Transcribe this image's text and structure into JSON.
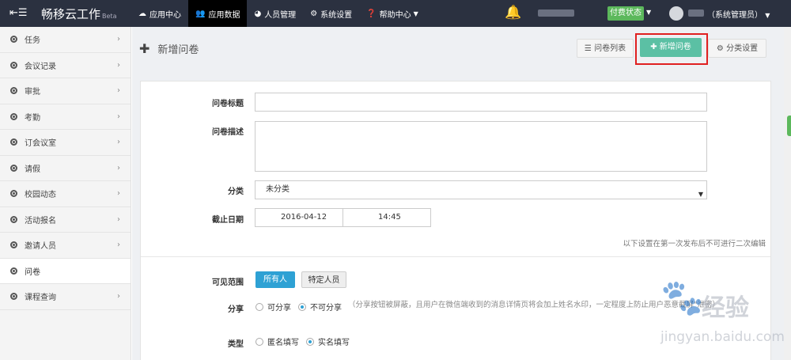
{
  "app": {
    "toggle_icon": "menu-collapse-icon",
    "brand": "畅移云工作",
    "beta": "Beta"
  },
  "nav": [
    {
      "label": "应用中心",
      "icon": "cloud-icon",
      "active": false
    },
    {
      "label": "应用数据",
      "icon": "users-icon",
      "active": true
    },
    {
      "label": "人员管理",
      "icon": "dashboard-icon",
      "active": false
    },
    {
      "label": "系统设置",
      "icon": "cogs-icon",
      "active": false
    },
    {
      "label": "帮助中心",
      "icon": "question-icon",
      "active": false
    }
  ],
  "header": {
    "paid_status": "付费状态",
    "role": "（系统管理员）"
  },
  "sidebar": {
    "items": [
      {
        "label": "任务"
      },
      {
        "label": "会议记录"
      },
      {
        "label": "审批"
      },
      {
        "label": "考勤"
      },
      {
        "label": "订会议室"
      },
      {
        "label": "请假"
      },
      {
        "label": "校园动态"
      },
      {
        "label": "活动报名"
      },
      {
        "label": "邀请人员"
      },
      {
        "label": "问卷",
        "active": true
      },
      {
        "label": "课程查询"
      }
    ]
  },
  "page": {
    "title": "新增问卷",
    "btn_list": "问卷列表",
    "btn_new": "新增问卷",
    "btn_category": "分类设置"
  },
  "form": {
    "title_label": "问卷标题",
    "title_value": "",
    "desc_label": "问卷描述",
    "desc_value": "",
    "category_label": "分类",
    "category_value": "未分类",
    "deadline_label": "截止日期",
    "deadline_date": "2016-04-12",
    "deadline_time": "14:45",
    "note": "以下设置在第一次发布后不可进行二次编辑",
    "visible_label": "可见范围",
    "visible_all": "所有人",
    "visible_specific": "特定人员",
    "share_label": "分享",
    "share_yes": "可分享",
    "share_no": "不可分享",
    "share_hint": "（分享按钮被屏蔽，且用户在微信端收到的消息详情页将会加上姓名水印，一定程度上防止用户恶意截屏\"泄密）",
    "type_label": "类型",
    "type_anonymous": "匿名填写",
    "type_realname": "实名填写"
  },
  "colors": {
    "topbar": "#2b3140",
    "accent_green": "#5bc0a4",
    "accent_blue": "#2ea1d4",
    "highlight": "#e02020"
  },
  "watermark": {
    "text": "经验",
    "url": "jingyan.baidu.com"
  }
}
